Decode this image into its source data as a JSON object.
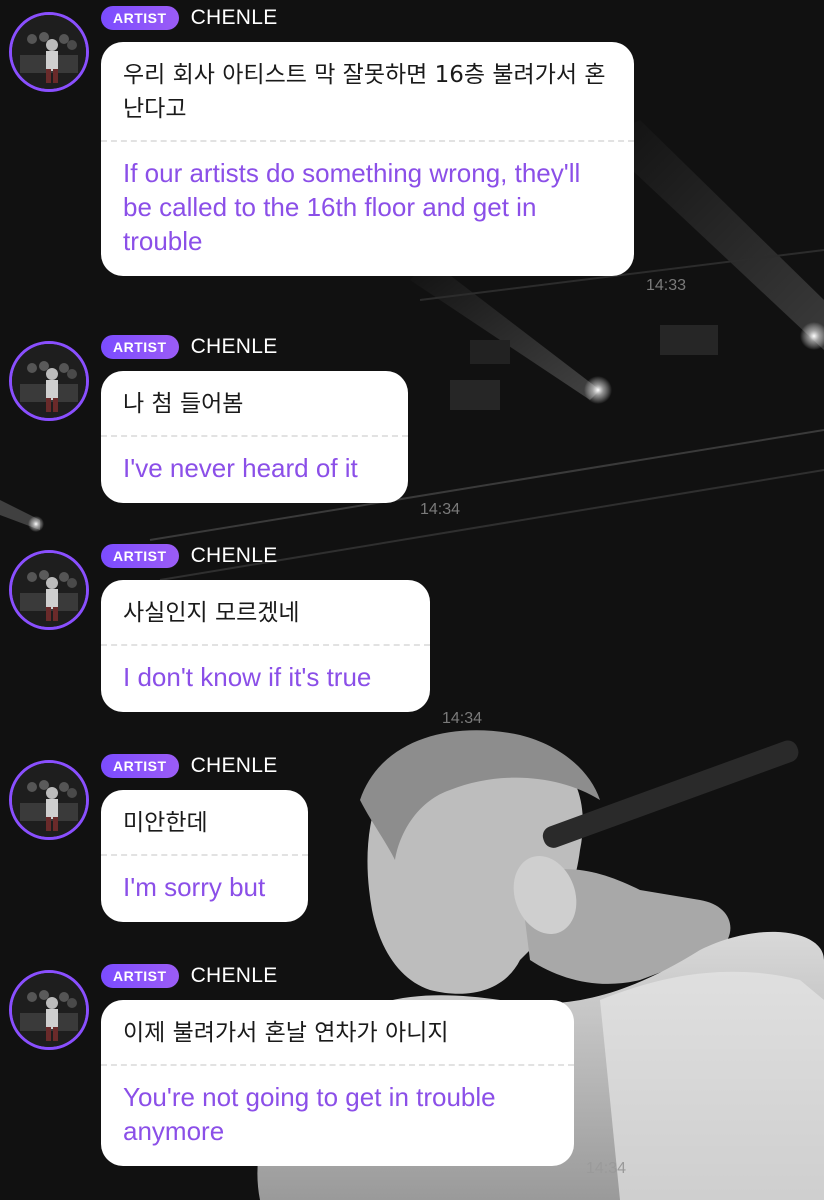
{
  "chat": {
    "messages": [
      {
        "badge": "ARTIST",
        "sender": "CHENLE",
        "korean": "우리 회사 아티스트 막 잘못하면 16층 불려가서 혼난다고",
        "translation": "If our artists do something wrong, they'll be called to the 16th floor and get in trouble",
        "time": "14:33"
      },
      {
        "badge": "ARTIST",
        "sender": "CHENLE",
        "korean": "나 첨 들어봄",
        "translation": "I've never heard of it",
        "time": "14:34"
      },
      {
        "badge": "ARTIST",
        "sender": "CHENLE",
        "korean": "사실인지 모르겠네",
        "translation": "I don't know if it's true",
        "time": "14:34"
      },
      {
        "badge": "ARTIST",
        "sender": "CHENLE",
        "korean": "미안한데",
        "translation": "I'm sorry but",
        "time": ""
      },
      {
        "badge": "ARTIST",
        "sender": "CHENLE",
        "korean": "이제 불려가서 혼날 연차가 아니지",
        "translation": "You're not going to get in trouble anymore",
        "time": "14:34"
      }
    ]
  },
  "colors": {
    "badge": "#8b5cf6",
    "translation_text": "#8b4fe8",
    "bubble": "#ffffff",
    "background": "#101010"
  },
  "icons": {
    "avatar": "artist-profile-photo"
  }
}
